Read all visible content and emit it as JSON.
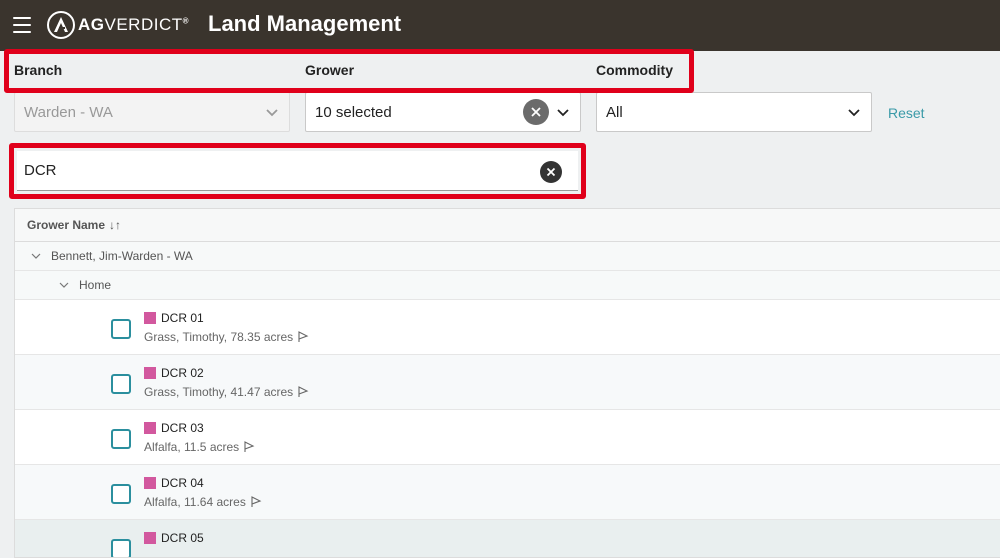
{
  "header": {
    "logo_bold": "AG",
    "logo_thin": "VERDICT",
    "logo_tm": "®",
    "title": "Land Management"
  },
  "filters": {
    "branch_label": "Branch",
    "grower_label": "Grower",
    "commodity_label": "Commodity",
    "branch_value": "Warden - WA",
    "grower_value": "10 selected",
    "commodity_value": "All",
    "reset_label": "Reset"
  },
  "search": {
    "value": "DCR"
  },
  "grid": {
    "column_header": "Grower Name",
    "sort_icon": "↓↑",
    "group_level1": "Bennett, Jim-Warden - WA",
    "group_level2": "Home",
    "fields": [
      {
        "name": "DCR 01",
        "detail": "Grass, Timothy, 78.35 acres"
      },
      {
        "name": "DCR 02",
        "detail": "Grass, Timothy, 41.47 acres"
      },
      {
        "name": "DCR 03",
        "detail": "Alfalfa, 11.5 acres"
      },
      {
        "name": "DCR 04",
        "detail": "Alfalfa, 11.64 acres"
      },
      {
        "name": "DCR 05",
        "detail": ""
      }
    ]
  },
  "colors": {
    "topbar": "#3a342d",
    "highlight": "#e0001b",
    "accent": "#2b8f9e",
    "field_swatch": "#d2589e"
  },
  "icons": [
    "hamburger-icon",
    "logo-icon",
    "chevron-down-icon",
    "clear-icon",
    "sort-icon",
    "caret-down-icon",
    "flag-icon"
  ]
}
